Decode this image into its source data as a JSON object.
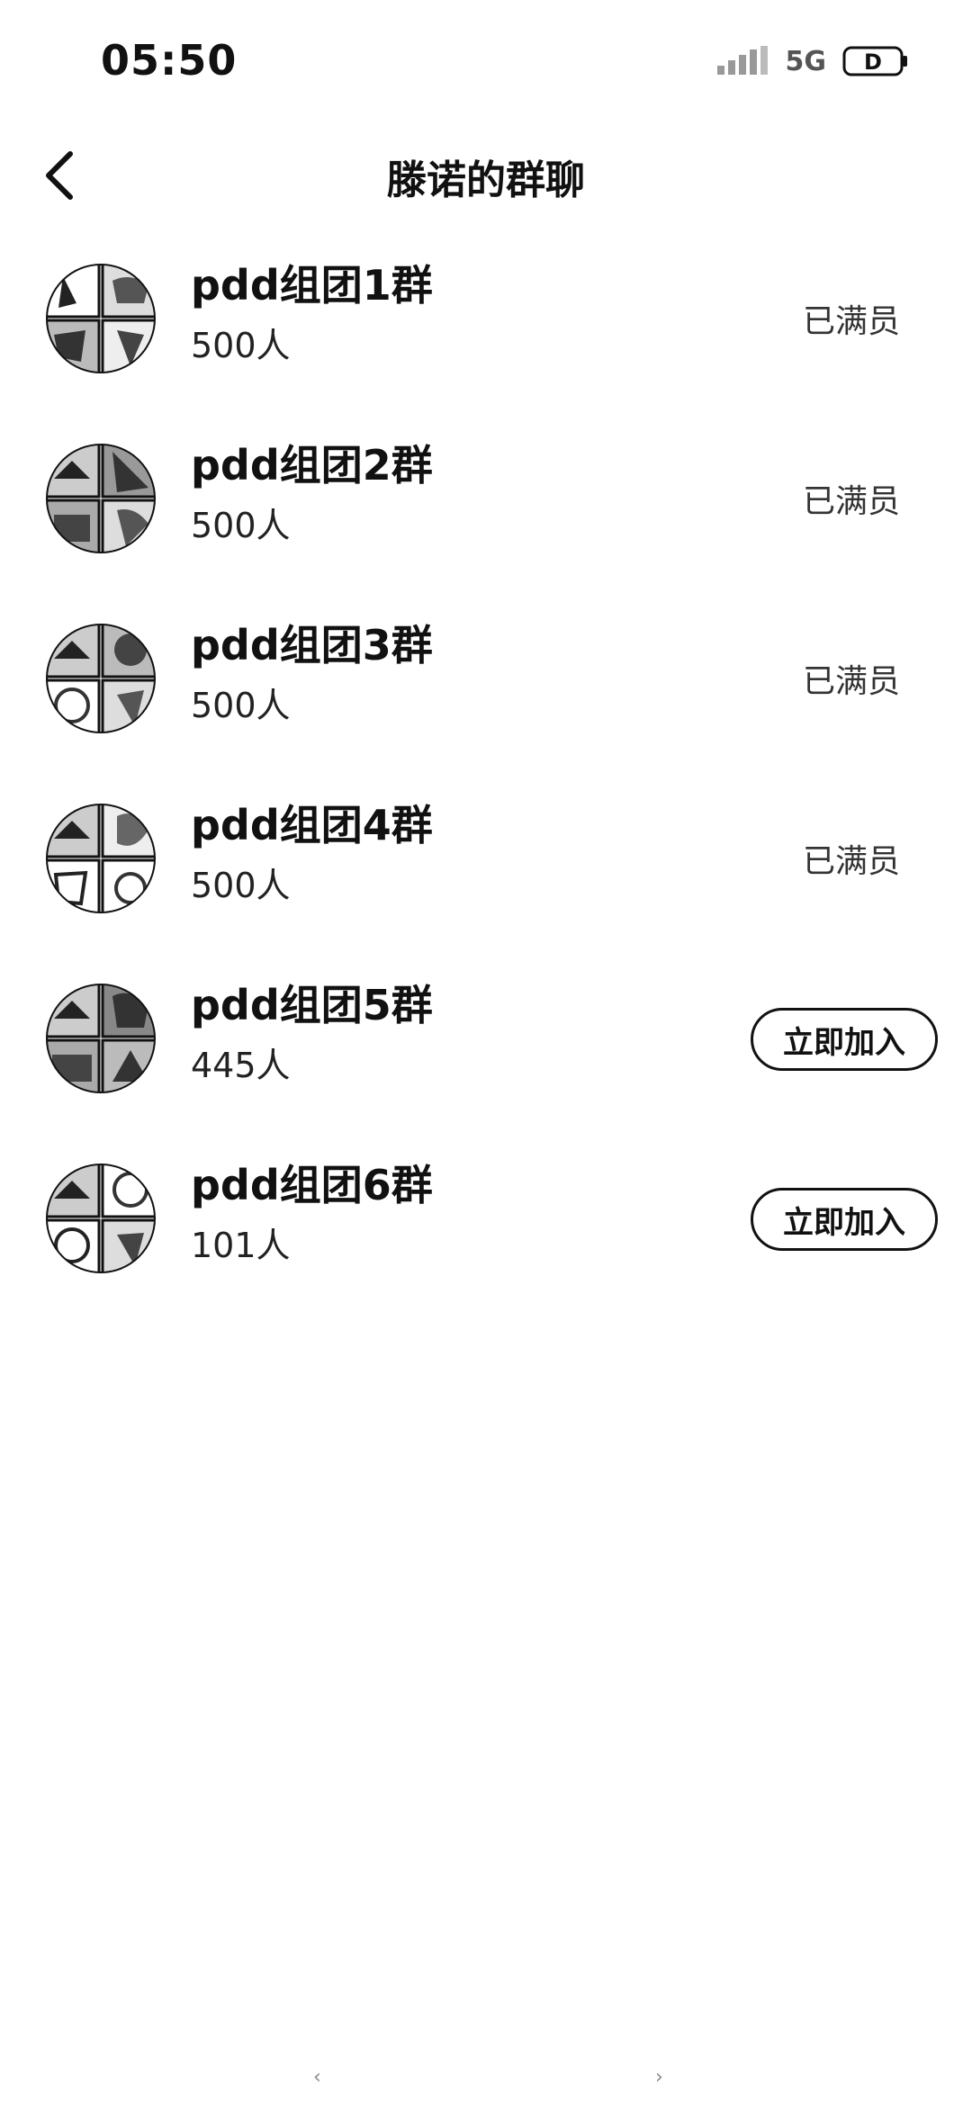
{
  "status_bar": {
    "time": "05:50",
    "network": "5G",
    "battery_label": "D"
  },
  "header": {
    "title": "滕诺的群聊"
  },
  "groups": [
    {
      "name": "pdd组团1群",
      "count": "500人",
      "status": "已满员"
    },
    {
      "name": "pdd组团2群",
      "count": "500人",
      "status": "已满员"
    },
    {
      "name": "pdd组团3群",
      "count": "500人",
      "status": "已满员"
    },
    {
      "name": "pdd组团4群",
      "count": "500人",
      "status": "已满员"
    },
    {
      "name": "pdd组团5群",
      "count": "445人",
      "action": "立即加入"
    },
    {
      "name": "pdd组团6群",
      "count": "101人",
      "action": "立即加入"
    }
  ],
  "nav": {
    "left_hint": "‹",
    "right_hint": "›"
  }
}
